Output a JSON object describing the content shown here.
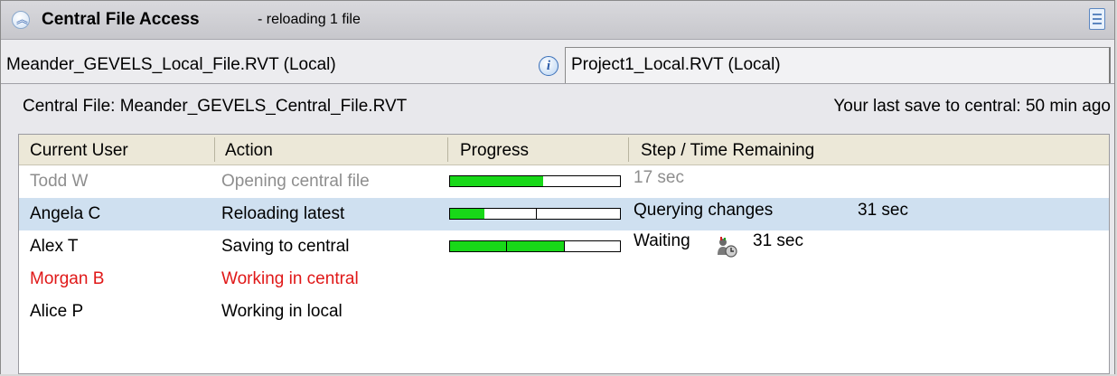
{
  "panel": {
    "title": "Central File Access",
    "status": "- reloading 1 file"
  },
  "tabs": [
    {
      "label": "Meander_GEVELS_Local_File.RVT (Local)"
    },
    {
      "label": "Project1_Local.RVT (Local)"
    }
  ],
  "info": {
    "central_file": "Central File:  Meander_GEVELS_Central_File.RVT",
    "last_save": "Your last save to central:  50 min ago"
  },
  "table": {
    "columns": [
      "Current User",
      "Action",
      "Progress",
      "Step / Time Remaining"
    ],
    "rows": [
      {
        "user": "Todd W",
        "action": "Opening central file",
        "progress": 0.55,
        "step": "17 sec",
        "time": "",
        "state": "inactive"
      },
      {
        "user": "Angela C",
        "action": "Reloading latest",
        "progress": 0.2,
        "step": "Querying changes",
        "time": "31 sec",
        "state": "selected"
      },
      {
        "user": "Alex T",
        "action": "Saving to central",
        "progress": 0.67,
        "step": "Waiting",
        "time": "31 sec",
        "state": "normal"
      },
      {
        "user": "Morgan B",
        "action": "Working in central",
        "progress": null,
        "step": "",
        "time": "",
        "state": "alert"
      },
      {
        "user": "Alice P",
        "action": "Working in local",
        "progress": null,
        "step": "",
        "time": "",
        "state": "normal"
      }
    ]
  },
  "colors": {
    "progress_fill": "#18d818",
    "selected_row": "#cfe0f0",
    "alert_text": "#e01818",
    "inactive_text": "#8e8e8e"
  },
  "icons": {
    "collapse": "chevron-up-icon",
    "notes": "document-icon",
    "info": "info-icon",
    "waiting": "waiting-user-icon"
  }
}
